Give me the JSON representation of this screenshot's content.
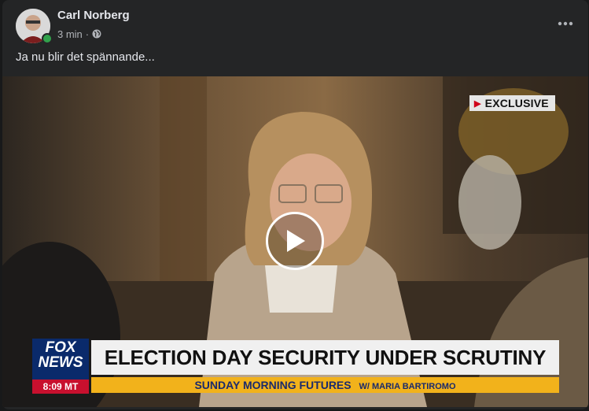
{
  "post": {
    "author": "Carl Norberg",
    "time": "3 min",
    "separator": "·",
    "text": "Ja nu blir det spännande...",
    "privacy_icon": "globe-icon",
    "more_icon": "more-options-icon"
  },
  "video": {
    "exclusive_label": "EXCLUSIVE",
    "logo_line1": "FOX",
    "logo_line2": "NEWS",
    "clock": "8:09 MT",
    "headline": "ELECTION DAY SECURITY UNDER SCRUTINY",
    "show_name": "SUNDAY MORNING FUTURES",
    "host": "W/ MARIA BARTIROMO",
    "play_icon": "play-icon"
  },
  "colors": {
    "background": "#18191a",
    "card": "#242526",
    "online": "#31a24c",
    "fox_blue": "#0a2a6b",
    "fox_red": "#c8102e",
    "show_bar": "#f2b21b"
  }
}
